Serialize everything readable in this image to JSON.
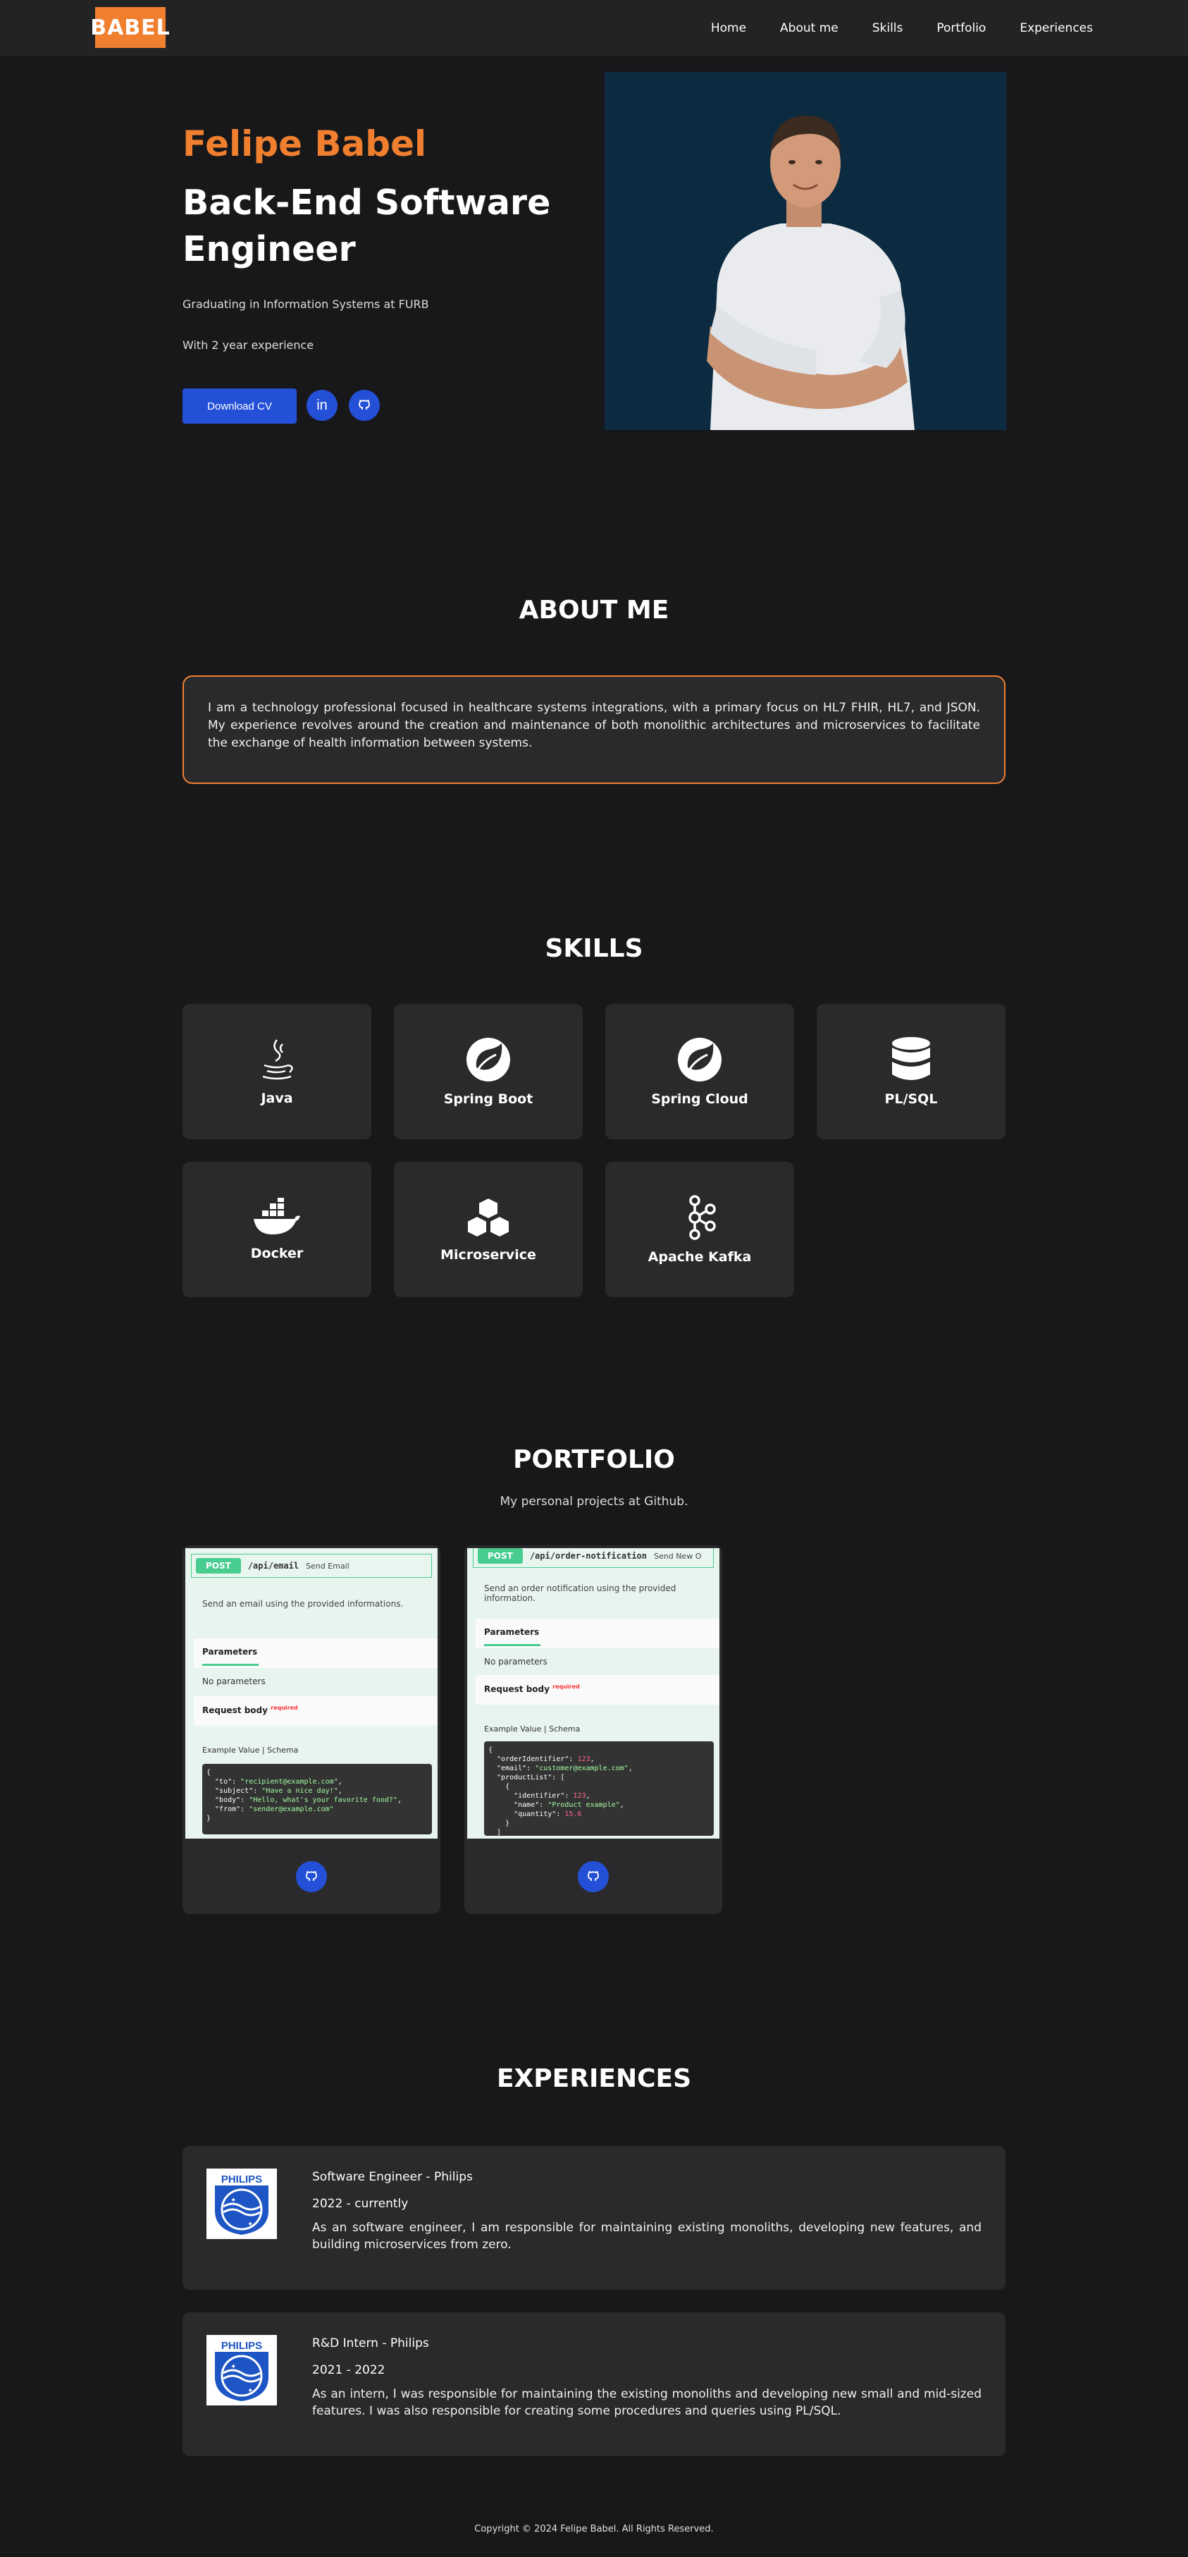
{
  "nav": {
    "logo": "BABEL",
    "links": [
      "Home",
      "About me",
      "Skills",
      "Portfolio",
      "Experiences"
    ]
  },
  "hero": {
    "name": "Felipe Babel",
    "role": "Back-End Software Engineer",
    "line1": "Graduating in Information Systems at FURB",
    "line2": "With 2 year experience",
    "cv_button": "Download CV"
  },
  "about": {
    "title": "ABOUT ME",
    "text": "I am a technology professional focused in healthcare systems integrations, with a primary focus on HL7 FHIR, HL7, and JSON. My experience revolves around the creation and maintenance of both monolithic architectures and microservices to facilitate the exchange of health information between systems."
  },
  "skills": {
    "title": "SKILLS",
    "items": [
      {
        "label": "Java",
        "icon": "java-icon"
      },
      {
        "label": "Spring Boot",
        "icon": "spring-icon"
      },
      {
        "label": "Spring Cloud",
        "icon": "spring-icon"
      },
      {
        "label": "PL/SQL",
        "icon": "database-icon"
      },
      {
        "label": "Docker",
        "icon": "docker-icon"
      },
      {
        "label": "Microservice",
        "icon": "cubes-icon"
      },
      {
        "label": "Apache Kafka",
        "icon": "kafka-icon"
      }
    ]
  },
  "portfolio": {
    "title": "PORTFOLIO",
    "subtitle": "My personal projects at Github.",
    "projects": [
      {
        "method": "POST",
        "path": "/api/email",
        "summary": "Send Email",
        "description": "Send an email using the provided informations.",
        "params_tab": "Parameters",
        "no_params": "No parameters",
        "request_body": "Request body",
        "required": "required",
        "example": "Example Value | Schema"
      },
      {
        "method": "POST",
        "path": "/api/order-notification",
        "summary": "Send New O",
        "description": "Send an order notification using the provided information.",
        "params_tab": "Parameters",
        "no_params": "No parameters",
        "request_body": "Request body",
        "required": "required",
        "example": "Example Value | Schema"
      }
    ]
  },
  "experiences": {
    "title": "EXPERIENCES",
    "items": [
      {
        "title": "Software Engineer - Philips",
        "period": "2022 - currently",
        "description": "As an software engineer, I am responsible for maintaining existing monoliths, developing new features, and building microservices from zero.",
        "logo_text": "PHILIPS"
      },
      {
        "title": "R&D Intern - Philips",
        "period": "2021 - 2022",
        "description": "As an intern, I was responsible for maintaining the existing monoliths and developing new small and mid-sized features. I was also responsible for creating some procedures and queries using PL/SQL.",
        "logo_text": "PHILIPS"
      }
    ]
  },
  "footer": {
    "text": "Copyright © 2024 Felipe Babel. All Rights Reserved."
  },
  "colors": {
    "accent": "#f07f2f",
    "button": "#2450d8",
    "background": "#18181a",
    "card": "#2a2a2c"
  }
}
